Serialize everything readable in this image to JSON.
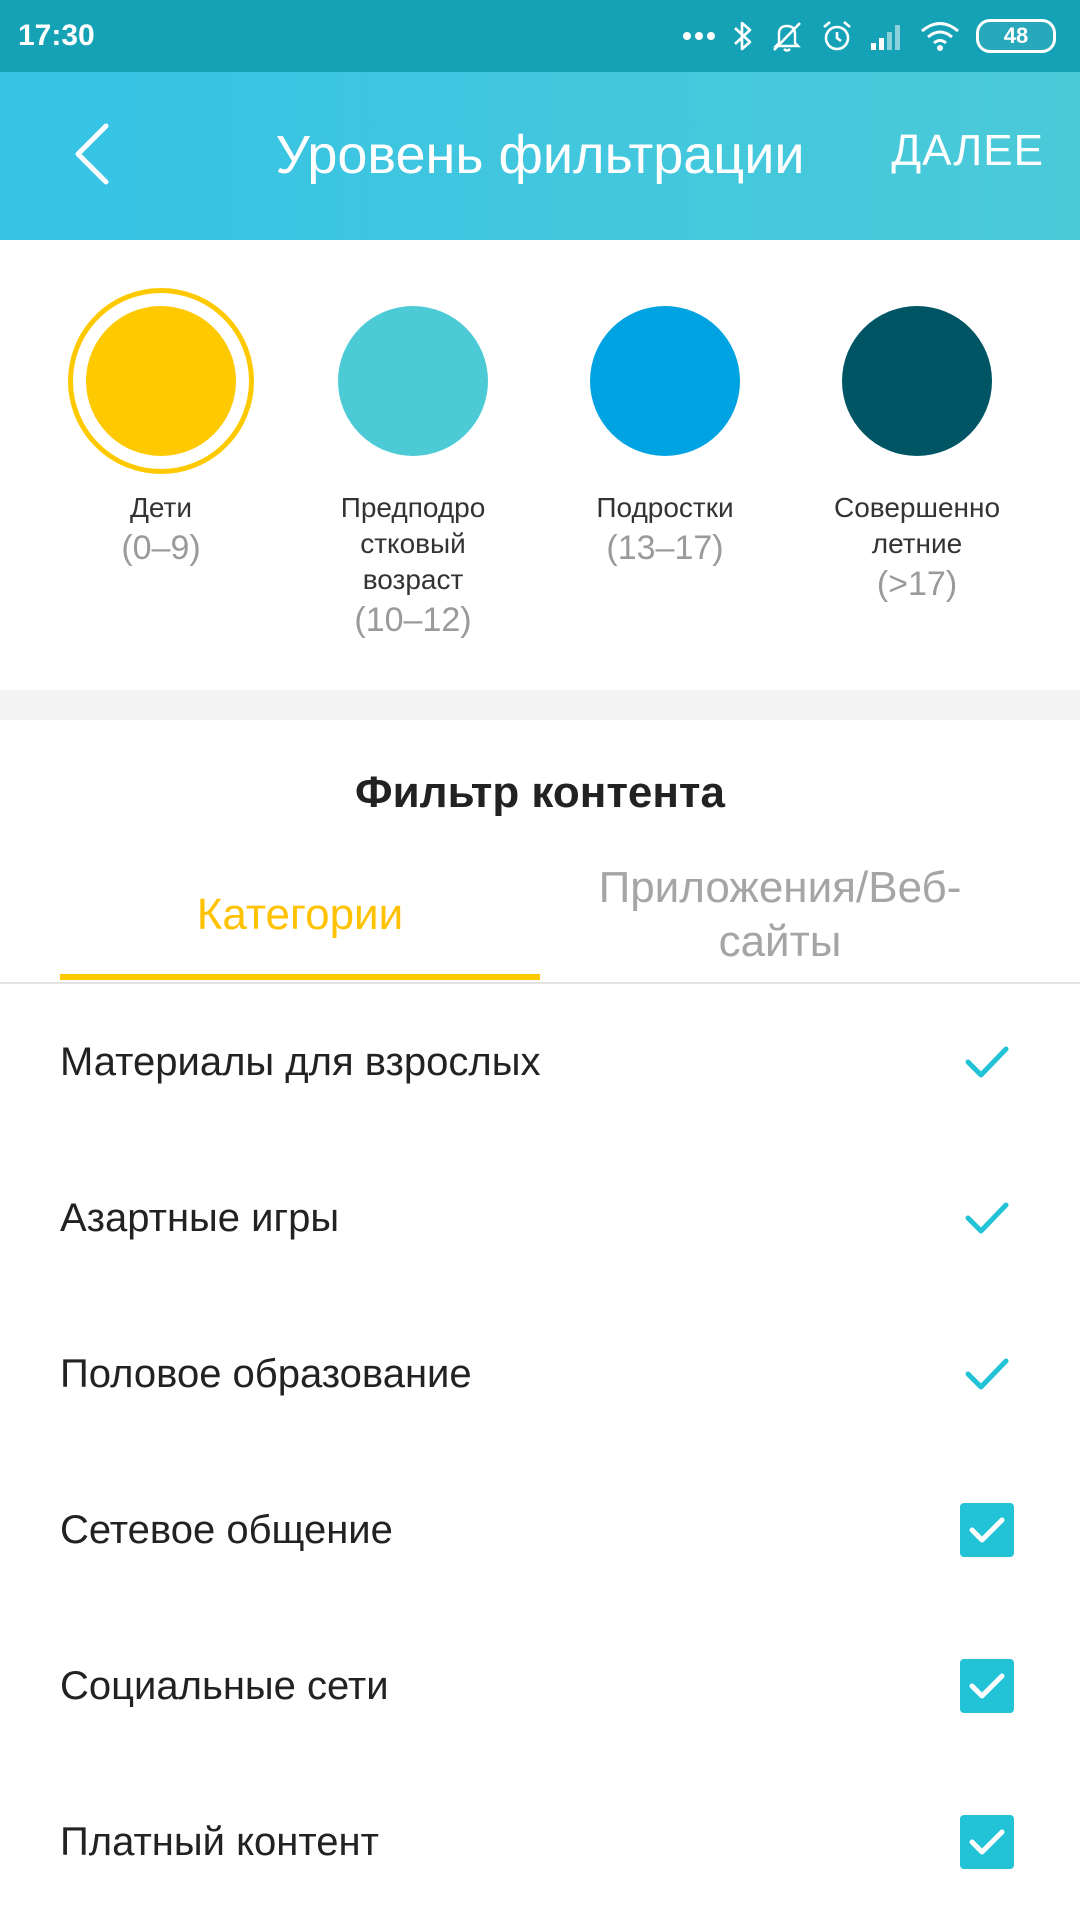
{
  "status_bar": {
    "time": "17:30",
    "battery": "48",
    "icons": [
      "more-dots-icon",
      "bluetooth-icon",
      "mute-bell-icon",
      "alarm-icon",
      "signal-icon",
      "wifi-icon",
      "battery-icon"
    ]
  },
  "app_bar": {
    "title": "Уровень фильтрации",
    "next_label": "ДАЛЕЕ",
    "back_icon": "chevron-left-icon"
  },
  "age_levels": [
    {
      "name": "Дети",
      "range": "(0–9)",
      "color": "#ffc900",
      "selected": true
    },
    {
      "name": "Предподро стковый возраст",
      "range": "(10–12)",
      "color": "#4ccbd6",
      "selected": false
    },
    {
      "name": "Подростки",
      "range": "(13–17)",
      "color": "#00a3e1",
      "selected": false
    },
    {
      "name": "Совершенно летние",
      "range": "(>17)",
      "color": "#005565",
      "selected": false
    }
  ],
  "content_filter": {
    "title": "Фильтр контента",
    "tabs": [
      {
        "label": "Категории",
        "active": true
      },
      {
        "label": "Приложения/Веб-сайты",
        "active": false
      }
    ],
    "categories": [
      {
        "label": "Материалы для взрослых",
        "state": "locked-check"
      },
      {
        "label": "Азартные игры",
        "state": "locked-check"
      },
      {
        "label": "Половое образование",
        "state": "locked-check"
      },
      {
        "label": "Сетевое общение",
        "state": "checked-box"
      },
      {
        "label": "Социальные сети",
        "state": "checked-box"
      },
      {
        "label": "Платный контент",
        "state": "checked-box"
      }
    ]
  },
  "colors": {
    "status_bar": "#16a2b6",
    "app_bar": "#3ec6e0",
    "accent_yellow": "#ffc900",
    "check_teal": "#22c3d6"
  }
}
